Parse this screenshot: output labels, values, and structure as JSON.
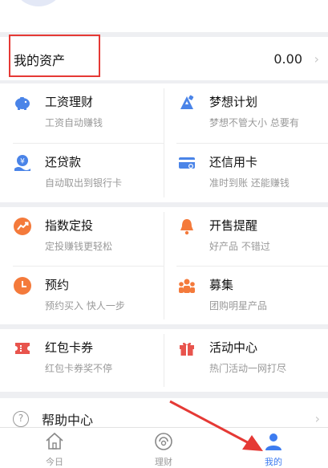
{
  "colors": {
    "accent_blue": "#4a84e8",
    "accent_orange": "#f47a3b",
    "accent_red": "#e8544d",
    "annotation_red": "#e53935",
    "text_primary": "#111111",
    "text_secondary": "#999999"
  },
  "assets": {
    "title": "我的资产",
    "value": "0.00",
    "arrow": "›"
  },
  "section1": {
    "items": [
      {
        "icon": "piggy-bank-icon",
        "title": "工资理财",
        "subtitle": "工资自动赚钱"
      },
      {
        "icon": "dream-plan-icon",
        "title": "梦想计划",
        "subtitle": "梦想不管大小 总要有"
      },
      {
        "icon": "loan-repay-icon",
        "title": "还贷款",
        "subtitle": "自动取出到银行卡"
      },
      {
        "icon": "credit-card-icon",
        "title": "还信用卡",
        "subtitle": "准时到账 还能赚钱"
      }
    ]
  },
  "section2": {
    "items": [
      {
        "icon": "trend-icon",
        "title": "指数定投",
        "subtitle": "定投赚钱更轻松"
      },
      {
        "icon": "bell-icon",
        "title": "开售提醒",
        "subtitle": "好产品 不错过"
      },
      {
        "icon": "clock-icon",
        "title": "预约",
        "subtitle": "预约买入 快人一步"
      },
      {
        "icon": "group-icon",
        "title": "募集",
        "subtitle": "团购明星产品"
      }
    ]
  },
  "section3": {
    "items": [
      {
        "icon": "coupon-icon",
        "title": "红包卡券",
        "subtitle": "红包卡券奖不停"
      },
      {
        "icon": "gift-icon",
        "title": "活动中心",
        "subtitle": "热门活动一网打尽"
      }
    ]
  },
  "help": {
    "icon_glyph": "?",
    "label": "帮助中心",
    "arrow": "›"
  },
  "tabbar": {
    "tabs": [
      {
        "icon": "home-icon",
        "label": "今日"
      },
      {
        "icon": "wealth-icon",
        "label": "理财"
      },
      {
        "icon": "user-icon",
        "label": "我的",
        "active": true
      }
    ]
  }
}
